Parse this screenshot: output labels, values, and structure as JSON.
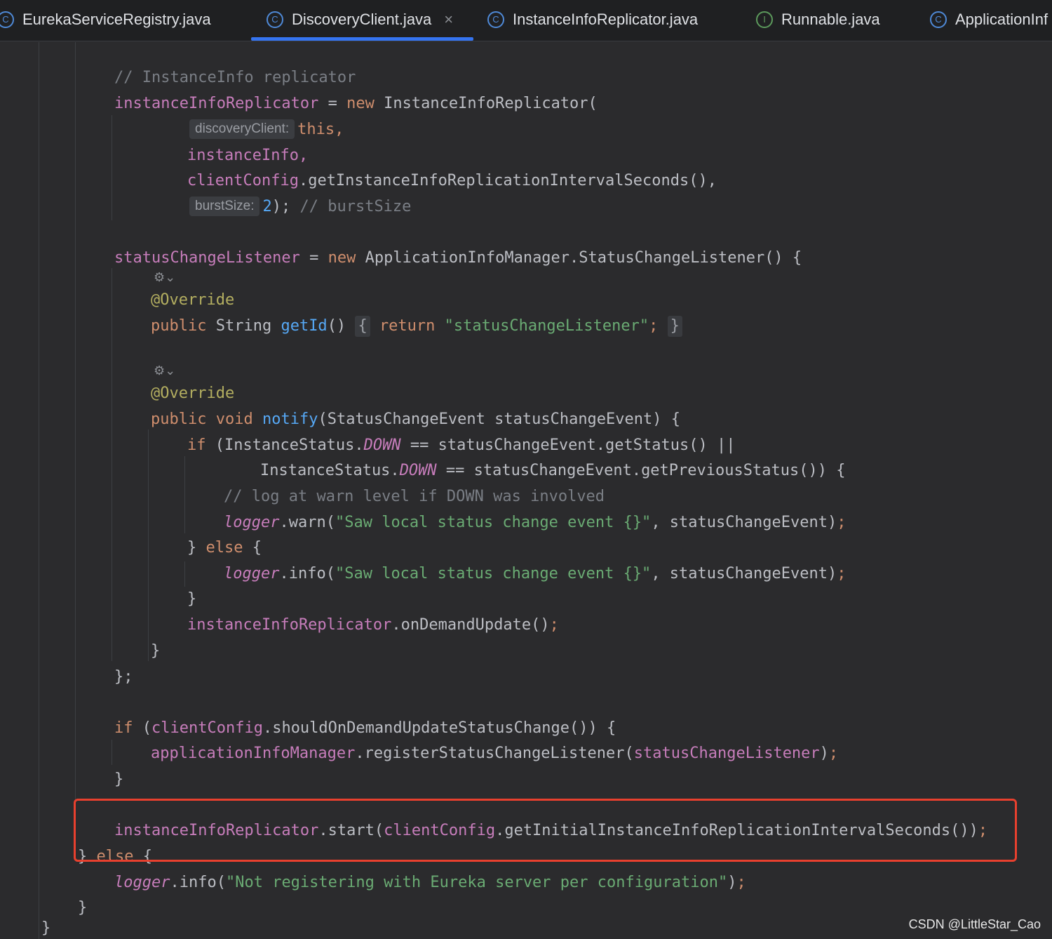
{
  "tabs": [
    {
      "label": "EurekaServiceRegistry.java",
      "icon": "class-icon"
    },
    {
      "label": "DiscoveryClient.java",
      "icon": "class-icon",
      "active": true
    },
    {
      "label": "InstanceInfoReplicator.java",
      "icon": "class-icon"
    },
    {
      "label": "Runnable.java",
      "icon": "interface-icon"
    },
    {
      "label": "ApplicationInf",
      "icon": "class-icon"
    }
  ],
  "icons": {
    "class": "C",
    "interface": "I",
    "close": "×",
    "gear": "⚙⌄"
  },
  "hints": {
    "discovery_client": "discoveryClient:",
    "burst_size": "burstSize:"
  },
  "code": {
    "c1": "// InstanceInfo replicator",
    "instance_info_replicator": "instanceInfoReplicator",
    "eq": " = ",
    "new": "new",
    "replicator_ctor": " InstanceInfoReplicator(",
    "this": "this,",
    "instance_info": "instanceInfo,",
    "client_config": "clientConfig",
    "get_interval": ".getInstanceInfoReplicationIntervalSeconds(),",
    "two": "2",
    "paren_semi": ");",
    "burst_comment": " // burstSize",
    "status_change_listener": "statusChangeListener",
    "listener_type": " ApplicationInfoManager.StatusChangeListener() {",
    "override": "@Override",
    "public": "public",
    "string": " String ",
    "get_id": "getId",
    "parens": "()",
    "brace_open": "{",
    "return": "return",
    "listener_str": "\"statusChangeListener\"",
    "semi": ";",
    "brace_close": "}",
    "void": " void ",
    "notify": "notify",
    "notify_params": "(StatusChangeEvent statusChangeEvent) {",
    "if": "if",
    "instance_status": " (InstanceStatus.",
    "down": "DOWN",
    "get_status": " == statusChangeEvent.getStatus() ||",
    "instance_status2": "InstanceStatus.",
    "get_prev_status": " == statusChangeEvent.getPreviousStatus()) {",
    "c2": "// log at warn level if DOWN was involved",
    "logger": "logger",
    "warn": ".warn(",
    "saw_str": "\"Saw local status change event {}\"",
    "event_arg": ", statusChangeEvent)",
    "close_else": "} ",
    "else": "else",
    "open_brace_sp": " {",
    "info": ".info(",
    "on_demand": ".onDemandUpdate()",
    "close_semi": "};",
    "if2_open": " (",
    "should_update": ".shouldOnDemandUpdateStatusChange()) {",
    "app_info_manager": "applicationInfoManager",
    "register": ".registerStatusChangeListener(",
    "close_paren": ")",
    "start": ".start(",
    "get_initial": ".getInitialInstanceInfoReplicationIntervalSeconds())",
    "not_registering": "\"Not registering with Eureka server per configuration\""
  },
  "watermark": "CSDN @LittleStar_Cao",
  "colors": {
    "highlight_box": "#e8402e",
    "active_tab": "#3574f0",
    "background": "#2b2b2d"
  }
}
